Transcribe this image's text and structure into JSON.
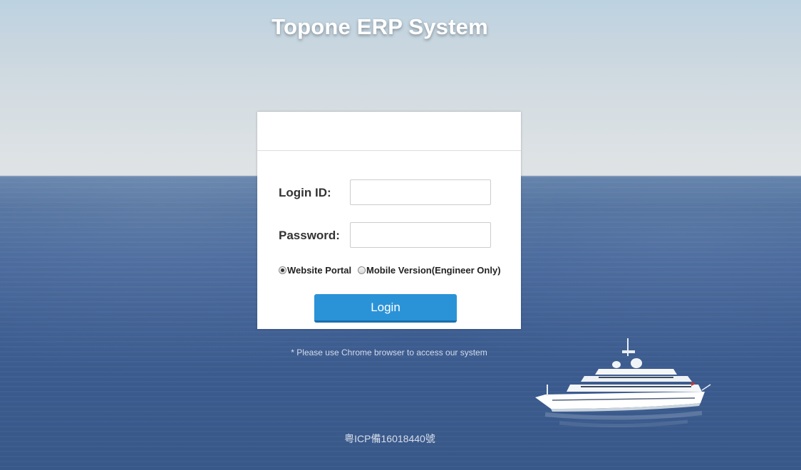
{
  "page": {
    "title": "Topone ERP System"
  },
  "login_form": {
    "login_id_label": "Login ID:",
    "login_id_value": "",
    "password_label": "Password:",
    "password_value": "",
    "radio_options": [
      {
        "label": "Website Portal",
        "checked": true
      },
      {
        "label": "Mobile Version(Engineer Only)",
        "checked": false
      }
    ],
    "login_button_label": "Login"
  },
  "notes": {
    "browser_note": "* Please use Chrome browser to access our system",
    "icp_footer": "粤ICP備16018440號"
  },
  "colors": {
    "accent": "#2a93d8",
    "panel_bg": "#ffffff"
  }
}
